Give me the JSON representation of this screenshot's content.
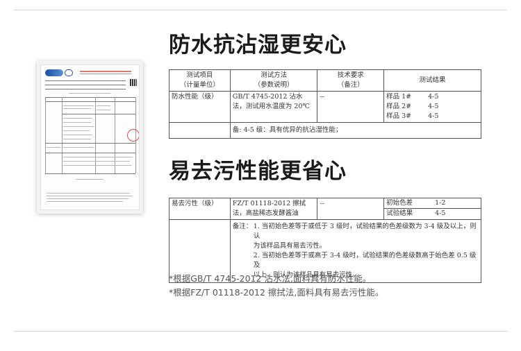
{
  "section1": {
    "title": "防水抗沾湿更安心",
    "headers": [
      "测试项目",
      "（计量单位）",
      "测试方法",
      "（参数说明）",
      "技术要求",
      "（备注）",
      "测试结果"
    ],
    "item": "防水性能（级）",
    "method": "GB/T 4745-2012 沾水法，测试用水温度为 20℃",
    "requirement": "--",
    "samples": [
      {
        "name": "样品 1#",
        "value": "4-5"
      },
      {
        "name": "样品 2#",
        "value": "4-5"
      },
      {
        "name": "样品 3#",
        "value": "4-5"
      }
    ],
    "note": "备: 4-5 级：具有优异的抗沾湿性能；"
  },
  "section2": {
    "title": "易去污性能更省心",
    "item": "易去污性（级）",
    "method": "FZ/T 01118-2012 擦拭法，高盐稀态发酵酱油",
    "requirement": "--",
    "results": [
      {
        "name": "初始色差",
        "value": "1-2"
      },
      {
        "name": "试验结果",
        "value": "4-5"
      }
    ],
    "note_label": "备注：",
    "note_lines": [
      "1. 当初始色差等于或低于 3 级时，试验结果的色差级数为 3-4 级及以上，则认",
      "为该样品具有易去污性。",
      "2. 当初始色差等于或高于 3-4 级时，试验结果的色差级数高于始色差 0.5 级及",
      "以上，则认为该样品具有易去污性。"
    ]
  },
  "footnotes": [
    "*根据GB/T 4745-2012 沾水法,面料具有防水性能。",
    "*根据FZ/T 01118-2012 擦拭法,面料具有易去污性能。"
  ]
}
